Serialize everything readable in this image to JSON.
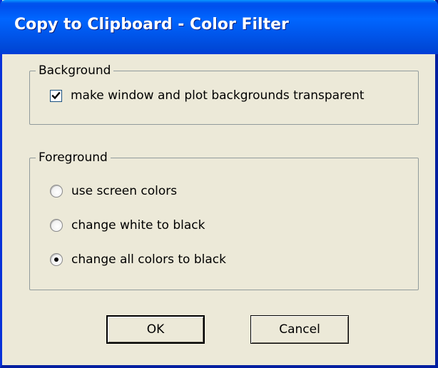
{
  "window": {
    "title": "Copy to Clipboard - Color Filter"
  },
  "background_group": {
    "legend": "Background",
    "transparent_checkbox": {
      "label": "make window and plot backgrounds transparent",
      "checked": true
    }
  },
  "foreground_group": {
    "legend": "Foreground",
    "options": [
      {
        "label": "use screen colors",
        "selected": false
      },
      {
        "label": "change white to black",
        "selected": false
      },
      {
        "label": "change all colors to black",
        "selected": true
      }
    ]
  },
  "buttons": {
    "ok_label": "OK",
    "cancel_label": "Cancel"
  },
  "colors": {
    "titlebar": "#0055ea",
    "dialog_bg": "#ece9d8",
    "group_border": "#919b9c"
  }
}
